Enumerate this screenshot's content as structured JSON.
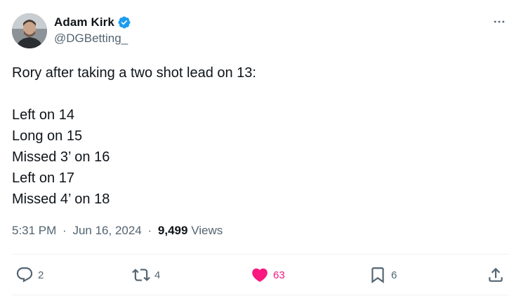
{
  "author": {
    "display_name": "Adam Kirk",
    "handle": "@DGBetting_",
    "verified": true
  },
  "tweet": {
    "lines": [
      "Rory after taking a two shot lead on 13:",
      "",
      "Left on 14",
      "Long on 15",
      "Missed 3’ on 16",
      "Left on 17",
      "Missed 4’ on 18"
    ],
    "time": "5:31 PM",
    "date": "Jun 16, 2024",
    "separator": "·",
    "views_count": "9,499",
    "views_label": "Views"
  },
  "actions": {
    "reply_count": "2",
    "retweet_count": "4",
    "like_count": "63",
    "bookmark_count": "6"
  },
  "icons": {
    "more": "more-horizontal-icon",
    "verified": "verified-badge-icon",
    "reply": "reply-icon",
    "retweet": "retweet-icon",
    "like": "heart-filled-icon",
    "bookmark": "bookmark-icon",
    "share": "share-icon"
  },
  "colors": {
    "text_primary": "#0f1419",
    "text_secondary": "#536471",
    "verified_blue": "#1d9bf0",
    "like_pink": "#f91880",
    "divider": "#eff3f4"
  }
}
